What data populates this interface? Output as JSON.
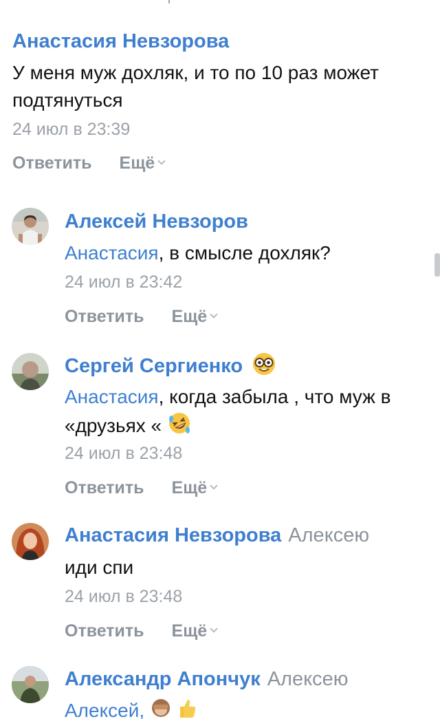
{
  "comments": [
    {
      "author": "Анастасия Невзорова",
      "text": "У меня муж дохляк, и то по 10 раз может подтянуться",
      "date": "24 июл в 23:39",
      "reply_label": "Ответить",
      "more_label": "Ещё"
    },
    {
      "author": "Алексей Невзоров",
      "mention": "Анастасия",
      "text": ", в смысле дохляк?",
      "date": "24 июл в 23:42",
      "reply_label": "Ответить",
      "more_label": "Ещё"
    },
    {
      "author": "Сергей Сергиенко",
      "author_emoji": "nerd-face",
      "mention": "Анастасия",
      "text_line1": ", когда забыла , что муж в",
      "text_line2": "«друзьях «",
      "text_emoji": "rolling-laughing-face",
      "date": "24 июл в 23:48",
      "reply_label": "Ответить",
      "more_label": "Ещё"
    },
    {
      "author": "Анастасия Невзорова",
      "reply_to": "Алексею",
      "text": "иди спи",
      "date": "24 июл в 23:48",
      "reply_label": "Ответить",
      "more_label": "Ещё"
    },
    {
      "author": "Александр Апончук",
      "reply_to": "Алексею",
      "text": "Алексей,",
      "text_emoji": "see-no-evil-monkey, thumbs-up"
    }
  ],
  "colors": {
    "link": "#3f7fcf",
    "secondary": "#8b939c",
    "date": "#9ba1a8"
  }
}
